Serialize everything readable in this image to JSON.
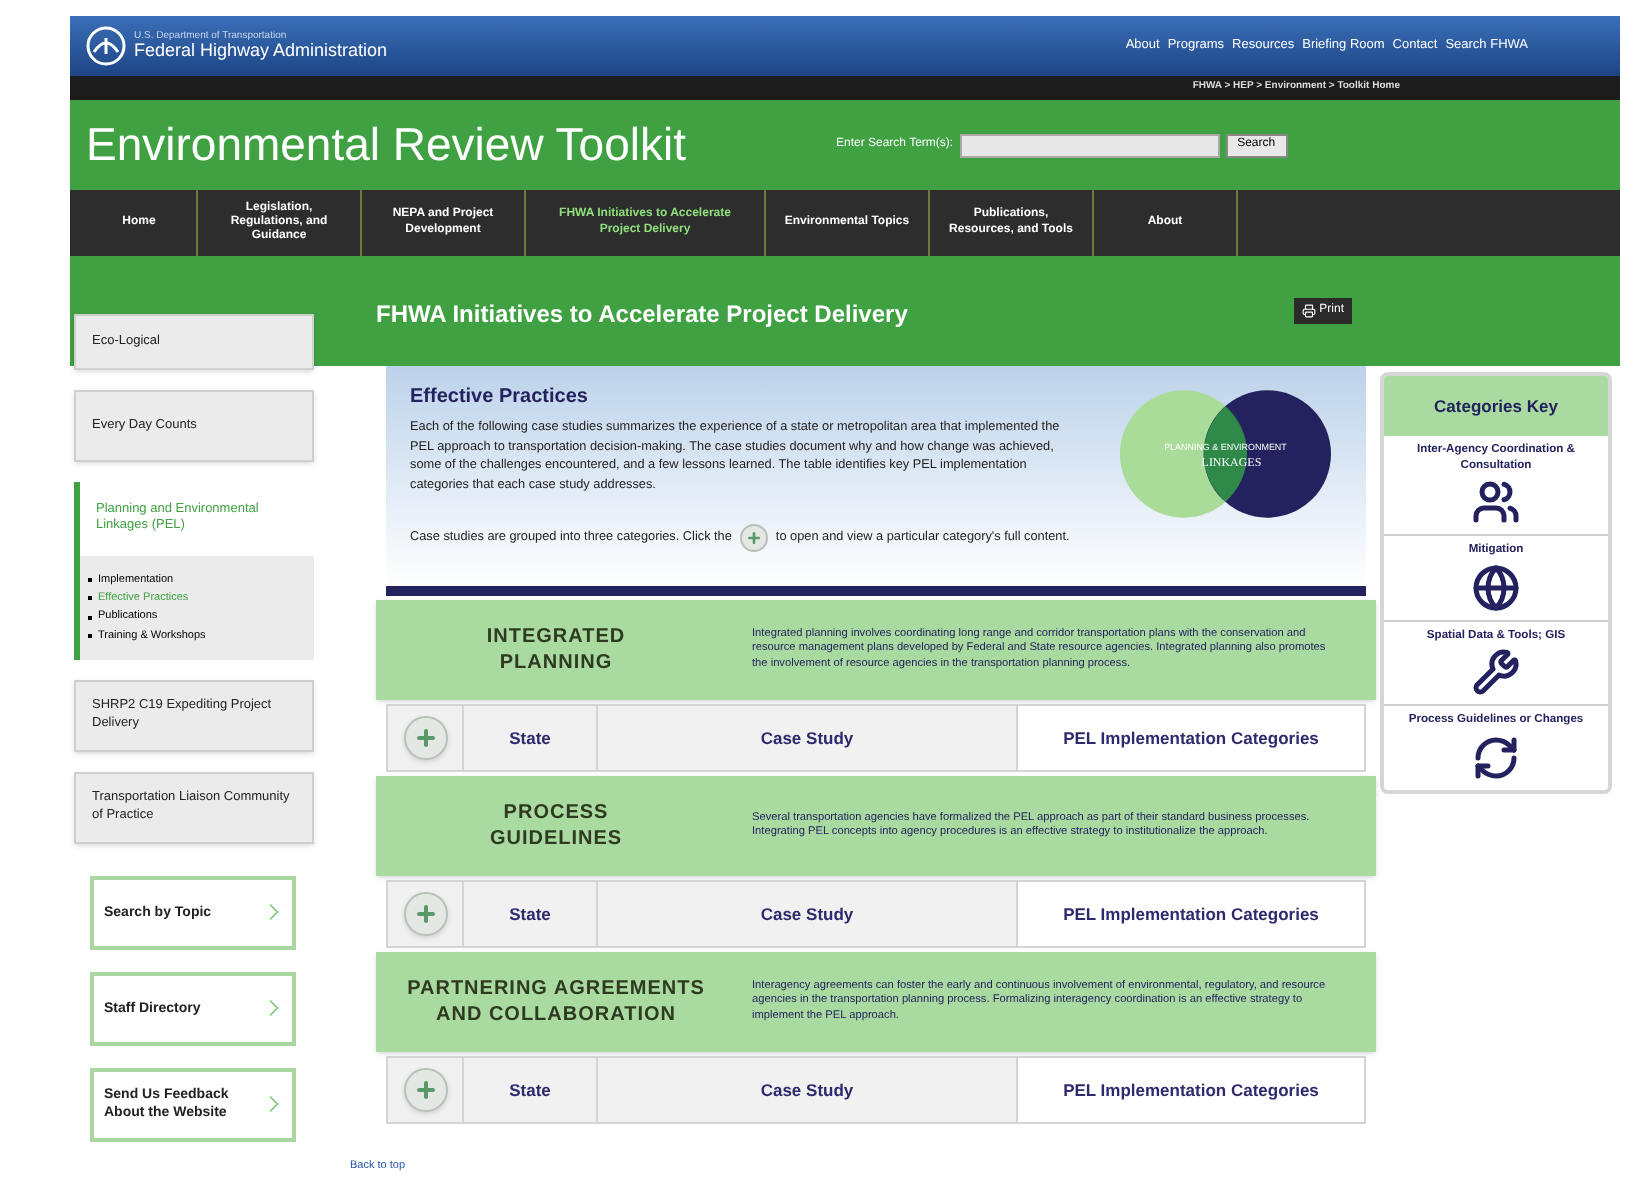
{
  "agency": {
    "department": "U.S. Department of Transportation",
    "name": "Federal Highway Administration"
  },
  "top_links": [
    "About",
    "Programs",
    "Resources",
    "Briefing Room",
    "Contact",
    "Search FHWA"
  ],
  "breadcrumb": "FHWA > HEP > Environment > Toolkit Home",
  "site_title": "Environmental Review Toolkit",
  "search": {
    "label": "Enter Search Term(s):",
    "button": "Search"
  },
  "nav": [
    {
      "label": "Home",
      "selected": false
    },
    {
      "label": "Legislation, Regulations, and Guidance",
      "selected": false
    },
    {
      "label": "NEPA and Project Development",
      "selected": false
    },
    {
      "label": "FHWA Initiatives to Accelerate Project Delivery",
      "selected": true
    },
    {
      "label": "Environmental Topics",
      "selected": false
    },
    {
      "label": "Publications, Resources, and Tools",
      "selected": false
    },
    {
      "label": "About",
      "selected": false
    }
  ],
  "page_title": "FHWA Initiatives to Accelerate Project Delivery",
  "print_button": "Print",
  "sidebar": {
    "items": [
      {
        "label": "Eco-Logical",
        "selected": false
      },
      {
        "label": "Every Day Counts",
        "selected": false
      },
      {
        "label": "Planning and Environmental Linkages (PEL)",
        "selected": true,
        "children": [
          {
            "label": "Implementation",
            "selected": false
          },
          {
            "label": "Effective Practices",
            "selected": true
          },
          {
            "label": "Publications",
            "selected": false
          },
          {
            "label": "Training & Workshops",
            "selected": false
          }
        ]
      },
      {
        "label": "SHRP2 C19 Expediting Project Delivery",
        "selected": false
      },
      {
        "label": "Transportation Liaison Community of Practice",
        "selected": false
      }
    ],
    "links": [
      "Search by Topic",
      "Staff Directory",
      "Send Us Feedback About the Website"
    ]
  },
  "intro": {
    "title": "Effective Practices",
    "text": "Each of the following case studies summarizes the experience of a state or metropolitan area that implemented the PEL approach to transportation decision-making. The case studies document why and how change was achieved, some of the challenges encountered, and a few lessons learned. The table identifies key PEL implementation categories that each case study addresses.",
    "hint_before": "Case studies are grouped into three categories. Click the",
    "hint_after": "to open and view a particular category's full content.",
    "logo": {
      "top": "PLANNING & ENVIRONMENT",
      "bottom": "LINKAGES"
    }
  },
  "categories": [
    {
      "title_lines": [
        "INTEGRATED",
        "PLANNING"
      ],
      "text": "Integrated planning involves coordinating long range and corridor transportation plans with the conservation and resource management plans developed by Federal and State resource agencies. Integrated planning also promotes the involvement of resource agencies in the transportation planning process.",
      "expanded": false,
      "columns": [
        "State",
        "Case Study",
        "PEL Implementation Categories"
      ]
    },
    {
      "title_lines": [
        "PROCESS",
        "GUIDELINES"
      ],
      "text": "Several transportation agencies have formalized the PEL approach as part of their standard business processes. Integrating PEL concepts into agency procedures is an effective strategy to institutionalize the approach.",
      "expanded": false,
      "columns": [
        "State",
        "Case Study",
        "PEL Implementation Categories"
      ]
    },
    {
      "title_lines": [
        "PARTNERING AGREEMENTS",
        "AND COLLABORATION"
      ],
      "text": "Interagency agreements can foster the early and continuous involvement of environmental, regulatory, and resource agencies in the transportation planning process. Formalizing interagency coordination is an effective strategy to implement the PEL approach.",
      "expanded": false,
      "columns": [
        "State",
        "Case Study",
        "PEL Implementation Categories"
      ]
    }
  ],
  "back_to_top": "Back to top",
  "categories_key": {
    "title": "Categories Key",
    "items": [
      {
        "label": "Inter-Agency Coordination & Consultation",
        "kind": "people"
      },
      {
        "label": "Mitigation",
        "kind": "globe"
      },
      {
        "label": "Spatial Data & Tools; GIS",
        "kind": "tools"
      },
      {
        "label": "Process Guidelines or Changes",
        "kind": "refresh"
      }
    ]
  }
}
